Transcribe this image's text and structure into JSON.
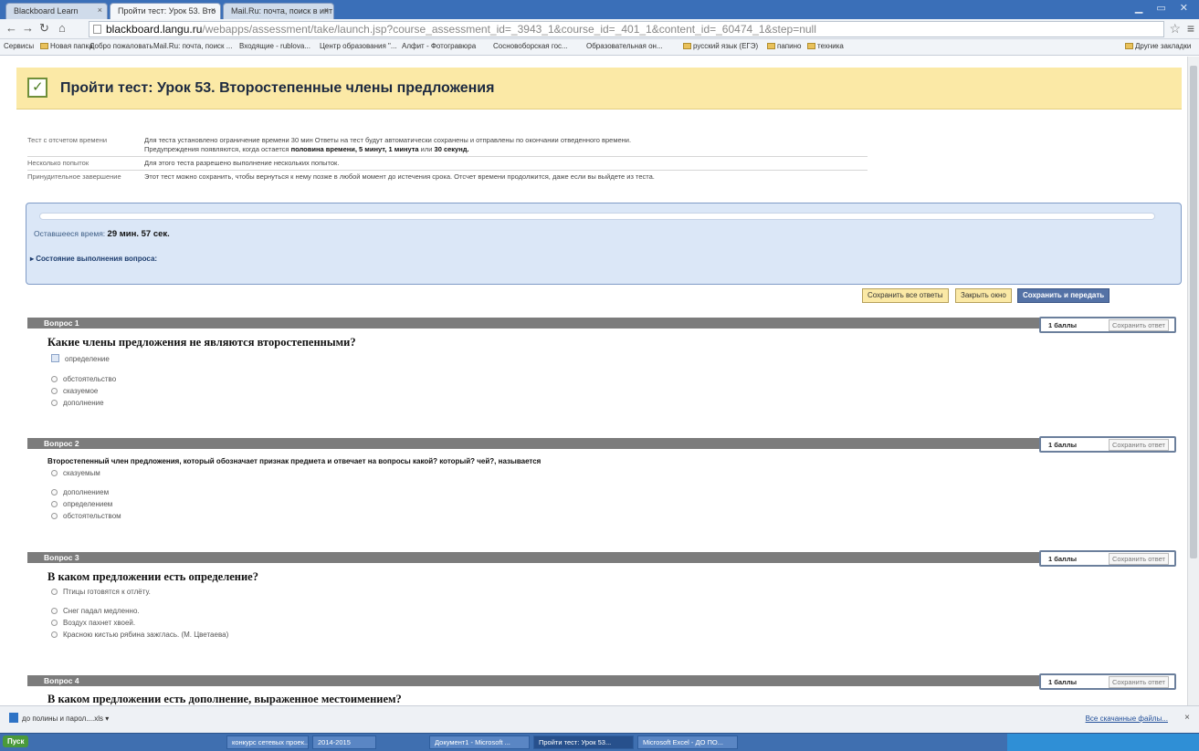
{
  "browser": {
    "tabs": [
      {
        "label": "Blackboard Learn"
      },
      {
        "label": "Пройти тест: Урок 53. Вто"
      },
      {
        "label": "Mail.Ru: почта, поиск в инт"
      }
    ],
    "url_host": "blackboard.langu.ru",
    "url_path": "/webapps/assessment/take/launch.jsp?course_assessment_id=_3943_1&course_id=_401_1&content_id=_60474_1&step=null",
    "bookmarks": [
      "Сервисы",
      "Новая папка",
      "Добро пожаловать",
      "Mail.Ru: почта, поиск ...",
      "Входящие - rublova...",
      "Центр образования \"...",
      "Алфит - Фотогравюра",
      "Сосновоборская гос...",
      "Образовательная он...",
      "русский язык (ЕГЭ)",
      "папино",
      "техника",
      "Другие закладки"
    ]
  },
  "page": {
    "title": "Пройти тест: Урок 53. Второстепенные члены предложения",
    "info": [
      {
        "label": "Тест с отсчетом времени",
        "text": "Для теста установлено ограничение времени 30 мин Ответы на тест будут автоматически сохранены и отправлены по окончании отведенного времени.",
        "text2_prefix": "Предупреждения появляются, когда остается ",
        "text2_bold1": "половина времени, 5 минут, 1 минута",
        "text2_mid": " или ",
        "text2_bold2": "30 секунд."
      },
      {
        "label": "Несколько попыток",
        "text": "Для этого теста разрешено выполнение нескольких попыток."
      },
      {
        "label": "Принудительное завершение",
        "text": "Этот тест можно сохранить, чтобы вернуться к нему позже в любой момент до истечения срока. Отсчет времени продолжится, даже если вы выйдете из теста."
      }
    ],
    "timer": {
      "label": "Оставшееся время:",
      "value": "29 мин. 57 сек.",
      "status_toggle": "Состояние выполнения вопроса:"
    },
    "actions": {
      "save_all": "Сохранить все ответы",
      "close_window": "Закрыть окно",
      "save_submit": "Сохранить и передать"
    },
    "questions": [
      {
        "header": "Вопрос 1",
        "points": "1 баллы",
        "save": "Сохранить ответ",
        "text": "Какие члены предложения не являются второстепенными?",
        "options": [
          "определение",
          "обстоятельство",
          "сказуемое",
          "дополнение"
        ]
      },
      {
        "header": "Вопрос 2",
        "points": "1 баллы",
        "save": "Сохранить ответ",
        "text": "Второстепенный член предложения, который обозначает признак предмета и отвечает на вопросы какой? который? чей?, называется",
        "options": [
          "сказуемым",
          "дополнением",
          "определением",
          "обстоятельством"
        ]
      },
      {
        "header": "Вопрос 3",
        "points": "1 баллы",
        "save": "Сохранить ответ",
        "text": "В каком предложении есть определение?",
        "options": [
          "Птицы готовятся к отлёту.",
          "Снег падал медленно.",
          "Воздух пахнет хвоей.",
          "Красною кистью рябина зажглась. (М. Цветаева)"
        ]
      },
      {
        "header": "Вопрос 4",
        "points": "1 баллы",
        "save": "Сохранить ответ",
        "text": "В каком предложении есть дополнение, выраженное местоимением?"
      }
    ]
  },
  "downloads": {
    "file": "до полины и парол....xls",
    "show_all": "Все скачанные файлы..."
  },
  "taskbar": {
    "start": "Пуск",
    "tasks": [
      "конкурс сетевых проек...",
      "2014-2015",
      "Документ1 - Microsoft ...",
      "Пройти тест: Урок 53...",
      "Microsoft Excel - ДО ПО..."
    ]
  }
}
